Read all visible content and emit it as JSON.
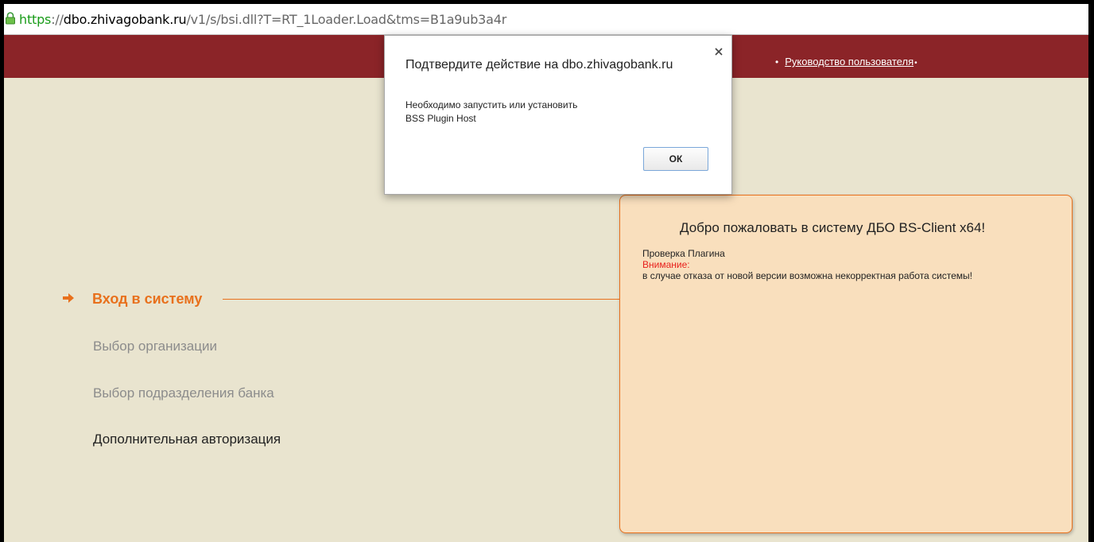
{
  "browser": {
    "url_scheme": "https",
    "url_separator": "://",
    "url_host": "dbo.zhivagobank.ru",
    "url_rest": "/v1/s/bsi.dll?T=RT_1Loader.Load&tms=B1a9ub3a4r"
  },
  "header": {
    "guide_link": "Руководство пользователя",
    "bullet": "•"
  },
  "steps": [
    {
      "label": "Вход в систему",
      "state": "active"
    },
    {
      "label": "Выбор организации",
      "state": "disabled"
    },
    {
      "label": "Выбор подразделения банка",
      "state": "disabled"
    },
    {
      "label": "Дополнительная авторизация",
      "state": "normal"
    }
  ],
  "welcome": {
    "title": "Добро пожаловать в систему ДБО BS-Client x64!",
    "plugin_check": "Проверка Плагина",
    "warning_label": "Внимание:",
    "warning_text": "в случае отказа от новой версии возможна некорректная работа системы!"
  },
  "dialog": {
    "title": "Подтвердите действие на dbo.zhivagobank.ru",
    "message_line1": "Необходимо запустить или установить",
    "message_line2": "BSS Plugin Host",
    "ok_label": "ОК"
  },
  "colors": {
    "header_bg": "#8b2428",
    "page_bg": "#e9e4cf",
    "accent": "#e8701c",
    "panel_bg": "#f9dfbd",
    "warning": "#e8201c"
  }
}
